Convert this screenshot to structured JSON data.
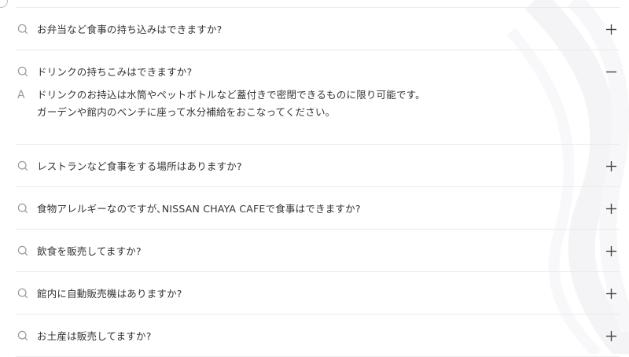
{
  "icons": {
    "question": "search-icon",
    "answer_letter": "A",
    "expand": "plus-icon",
    "collapse": "minus-icon"
  },
  "colors": {
    "text": "#333333",
    "icon": "#9a9a9a",
    "divider": "#ebebeb",
    "background": "#ffffff"
  },
  "faq": [
    {
      "question": "お弁当など食事の持ち込みはできますか?",
      "expanded": false
    },
    {
      "question": "ドリンクの持ちこみはできますか?",
      "expanded": true,
      "answer_lines": [
        "ドリンクのお持込は水筒やペットボトルなど蓋付きで密閉できるものに限り可能です。",
        "ガーデンや館内のベンチに座って水分補給をおこなってください。"
      ]
    },
    {
      "question": "レストランなど食事をする場所はありますか?",
      "expanded": false
    },
    {
      "question": "食物アレルギーなのですが､NISSAN CHAYA CAFEで食事はできますか?",
      "expanded": false
    },
    {
      "question": "飲食を販売してますか?",
      "expanded": false
    },
    {
      "question": "館内に自動販売機はありますか?",
      "expanded": false
    },
    {
      "question": "お土産は販売してますか?",
      "expanded": false
    }
  ]
}
